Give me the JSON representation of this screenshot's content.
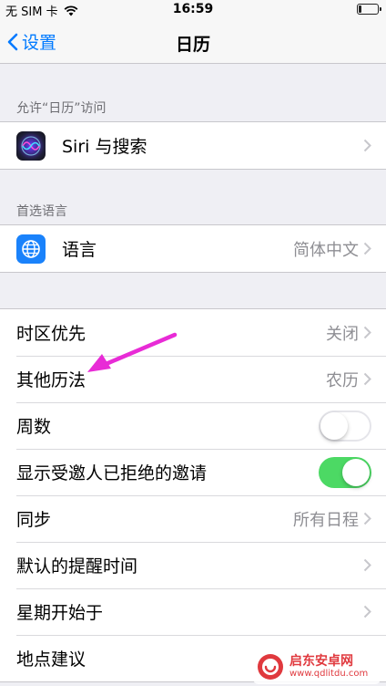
{
  "status_bar": {
    "carrier": "无 SIM 卡",
    "time": "16:59",
    "battery_level": 0.15
  },
  "nav": {
    "back_label": "设置",
    "title": "日历"
  },
  "sections": {
    "access_header": "允许“日历”访问",
    "siri_label": "Siri 与搜索",
    "language_header": "首选语言",
    "language_label": "语言",
    "language_value": "简体中文"
  },
  "settings": {
    "timezone_label": "时区优先",
    "timezone_value": "关闭",
    "alt_calendar_label": "其他历法",
    "alt_calendar_value": "农历",
    "week_numbers_label": "周数",
    "week_numbers_on": false,
    "show_declined_label": "显示受邀人已拒绝的邀请",
    "show_declined_on": true,
    "sync_label": "同步",
    "sync_value": "所有日程",
    "default_alert_label": "默认的提醒时间",
    "week_start_label": "星期开始于",
    "location_label": "地点建议"
  },
  "colors": {
    "accent": "#007aff",
    "toggle_on": "#4cd964",
    "annotation_arrow": "#e82bd6"
  },
  "watermark": {
    "title": "启东安卓网",
    "url": "www.qdlitdu.com"
  }
}
